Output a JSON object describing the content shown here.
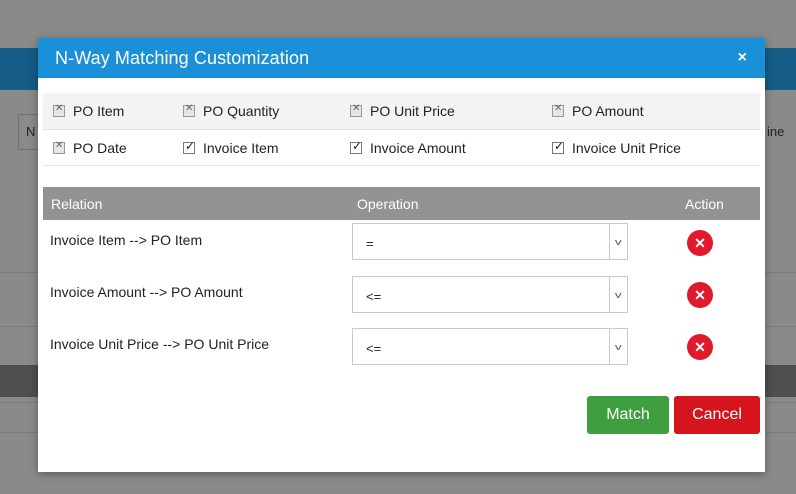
{
  "background": {
    "left_text": "N",
    "right_text": "ine"
  },
  "modal": {
    "title": "N-Way Matching Customization",
    "close_label": "×",
    "checkboxes": [
      {
        "label": "PO Item",
        "state": "disabled"
      },
      {
        "label": "PO Quantity",
        "state": "disabled"
      },
      {
        "label": "PO Unit Price",
        "state": "disabled"
      },
      {
        "label": "PO Amount",
        "state": "disabled"
      },
      {
        "label": "PO Date",
        "state": "disabled"
      },
      {
        "label": "Invoice Item",
        "state": "checked"
      },
      {
        "label": "Invoice Amount",
        "state": "checked"
      },
      {
        "label": "Invoice Unit Price",
        "state": "checked"
      }
    ],
    "table": {
      "headers": {
        "relation": "Relation",
        "operation": "Operation",
        "action": "Action"
      },
      "rows": [
        {
          "relation": "Invoice Item --> PO Item",
          "operation": "="
        },
        {
          "relation": "Invoice Amount --> PO Amount",
          "operation": "<="
        },
        {
          "relation": "Invoice Unit Price --> PO Unit Price",
          "operation": "<="
        }
      ]
    },
    "buttons": {
      "match": "Match",
      "cancel": "Cancel"
    }
  },
  "colors": {
    "header": "#1a90d9",
    "match": "#3f9f40",
    "cancel": "#d5141d",
    "delete": "#e0192c",
    "table_header": "#939393"
  },
  "icons": {
    "delete": "x-circle-icon",
    "close": "close-icon",
    "dropdown": "chevron-down-icon"
  }
}
